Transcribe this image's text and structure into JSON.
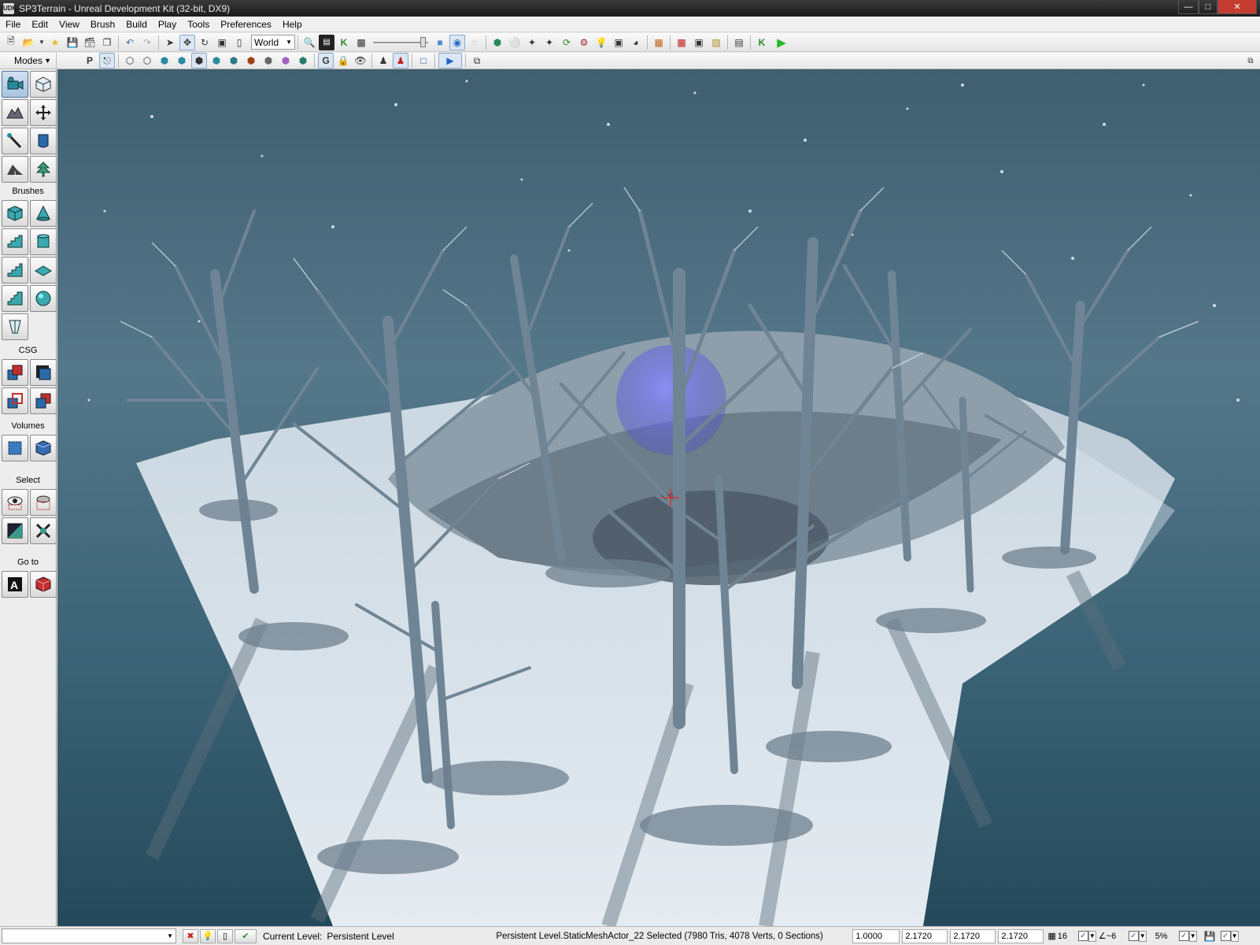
{
  "window": {
    "title": "SP3Terrain - Unreal Development Kit (32-bit, DX9)",
    "app_icon_text": "UDK"
  },
  "menu": [
    "File",
    "Edit",
    "View",
    "Brush",
    "Build",
    "Play",
    "Tools",
    "Preferences",
    "Help"
  ],
  "toolbar": {
    "coordinate_system": "World",
    "icons_left": [
      "new-file-icon",
      "open-file-icon",
      "open-dropdown-icon",
      "favorite-star-icon",
      "save-icon",
      "save-as-icon",
      "save-all-icon",
      "undo-icon",
      "redo-icon"
    ],
    "transform_icons": [
      "select-icon",
      "translate-icon",
      "rotate-icon",
      "scale-icon",
      "nonuniform-scale-icon"
    ],
    "icons_right": [
      "find-actor-icon",
      "content-browser-icon",
      "kismet-icon",
      "matinee-icon",
      "generic-browser-icon",
      "cascade-icon",
      "star-icon",
      "build-geometry-icon",
      "build-lighting-icon",
      "build-paths-icon",
      "build-cover-icon",
      "build-all-icon",
      "lighting-quality-icon",
      "lightmass-icon",
      "swarm-icon",
      "submit-icon",
      "play-in-editor-icon",
      "console-icon",
      "play-on-pc-icon",
      "kismet-debug-icon",
      "play-icon"
    ]
  },
  "modes": {
    "header": "Modes"
  },
  "viewport_toolbar": {
    "icons": [
      "perspective-p-icon",
      "realtime-icon",
      "wireframe-icon",
      "brush-wireframe-icon",
      "unlit-icon",
      "lit-icon",
      "detail-lighting-icon",
      "lighting-only-icon",
      "light-complexity-icon",
      "texture-density-icon",
      "shader-complexity-icon",
      "lightmap-density-icon",
      "game-view-g-icon",
      "lock-icon",
      "show-flags-eye-icon",
      "actor-visibility-icon",
      "streaming-volume-icon",
      "level-bounds-icon",
      "play-viewport-icon",
      "maximize-viewport-icon"
    ],
    "restore_icon": "restore-viewport-icon"
  },
  "sidebar": {
    "top_buttons": [
      "camera-mode-icon",
      "geometry-mode-icon",
      "terrain-mode-icon",
      "transform-widget-icon",
      "texture-align-icon",
      "mesh-paint-icon",
      "landscape-mode-icon",
      "foliage-mode-icon"
    ],
    "sections": [
      {
        "label": "Brushes",
        "buttons": [
          "cube-builder-icon",
          "cone-builder-icon",
          "curved-stair-icon",
          "cylinder-builder-icon",
          "linear-stair-icon",
          "plane-builder-icon",
          "spiral-stair-icon",
          "sphere-builder-icon",
          "volumetric-builder-icon"
        ]
      },
      {
        "label": "CSG",
        "buttons": [
          "csg-add-icon",
          "csg-subtract-icon",
          "csg-intersect-icon",
          "csg-deintersect-icon"
        ]
      },
      {
        "label": "Volumes",
        "buttons": [
          "add-volume-icon",
          "blocking-volume-icon"
        ]
      },
      {
        "label": "Select",
        "buttons": [
          "show-selected-icon",
          "hide-selected-icon",
          "select-invert-icon",
          "show-all-icon"
        ]
      },
      {
        "label": "Go to",
        "buttons": [
          "goto-actor-icon",
          "goto-builder-brush-icon"
        ]
      }
    ]
  },
  "status": {
    "current_level_label": "Current Level:",
    "current_level_value": "Persistent Level",
    "selection_text": "Persistent Level.StaticMeshActor_22 Selected (7980 Tris, 4078 Verts, 0 Sections)",
    "drag_grid": "1.0000",
    "scale_x": "2.1720",
    "scale_y": "2.1720",
    "scale_z": "2.1720",
    "grid_size": "16",
    "rotation_snap": "~6",
    "scale_snap": "5%"
  },
  "colors": {
    "accent": "#4a7fb5",
    "play_green": "#2bb52b",
    "viewport_sky": "#3b6679",
    "snow": "#dfe7ee"
  }
}
